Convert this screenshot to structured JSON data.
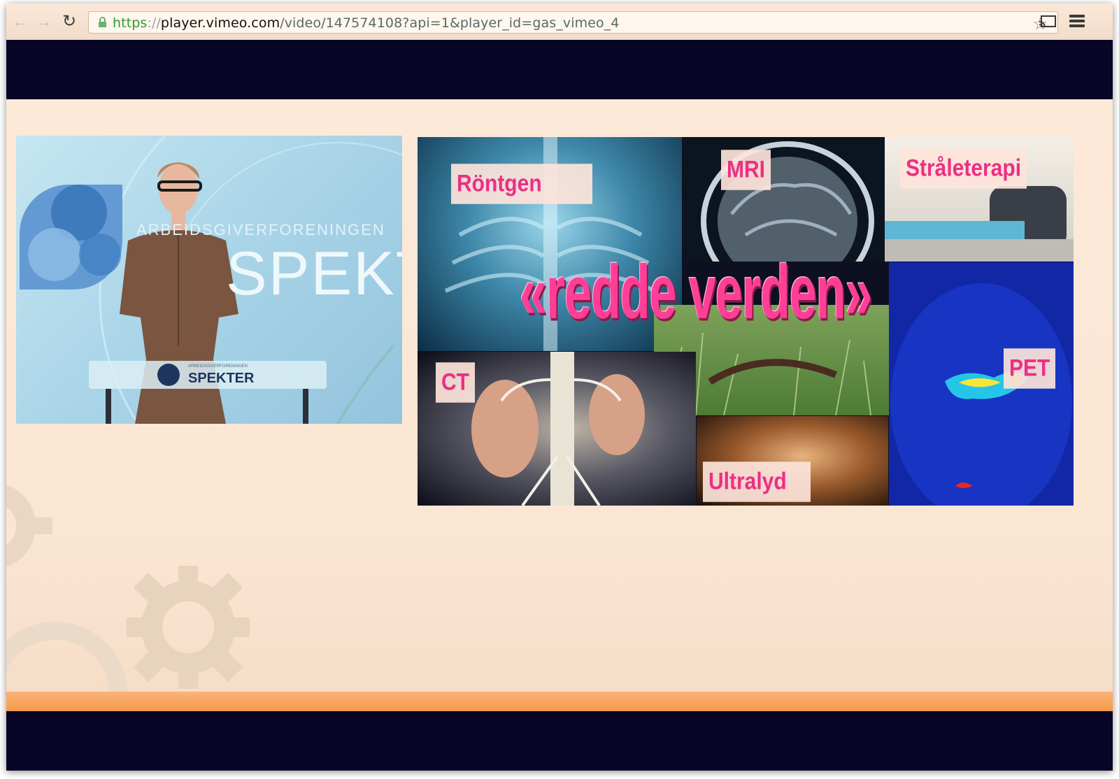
{
  "browser": {
    "back_icon": "back-arrow-icon",
    "forward_icon": "forward-arrow-icon",
    "reload_icon": "reload-icon",
    "url": {
      "scheme": "https",
      "separator": "://",
      "host": "player.vimeo.com",
      "path": "/video/147574108?api=1&player_id=gas_vimeo_4"
    },
    "star_icon": "bookmark-star-icon",
    "cast_icon": "cast-icon",
    "menu_icon": "menu-icon"
  },
  "speaker_video": {
    "org_small": "ARBEIDSGIVERFORENINGEN",
    "org_big": "SPEKTER",
    "podium_small": "ARBEIDSGIVERFORENINGEN",
    "podium_logo": "SPEKTER"
  },
  "collage": {
    "labels": {
      "rontgen": "Röntgen",
      "mri": "MRI",
      "straleterapi": "Stråleterapi",
      "ct": "CT",
      "ultralyd": "Ultralyd",
      "pet": "PET"
    },
    "headline": "«redde verden»"
  },
  "colors": {
    "accent_pink": "#ec2f84",
    "letterbox": "#080626",
    "stripe": "#f59a4b"
  }
}
